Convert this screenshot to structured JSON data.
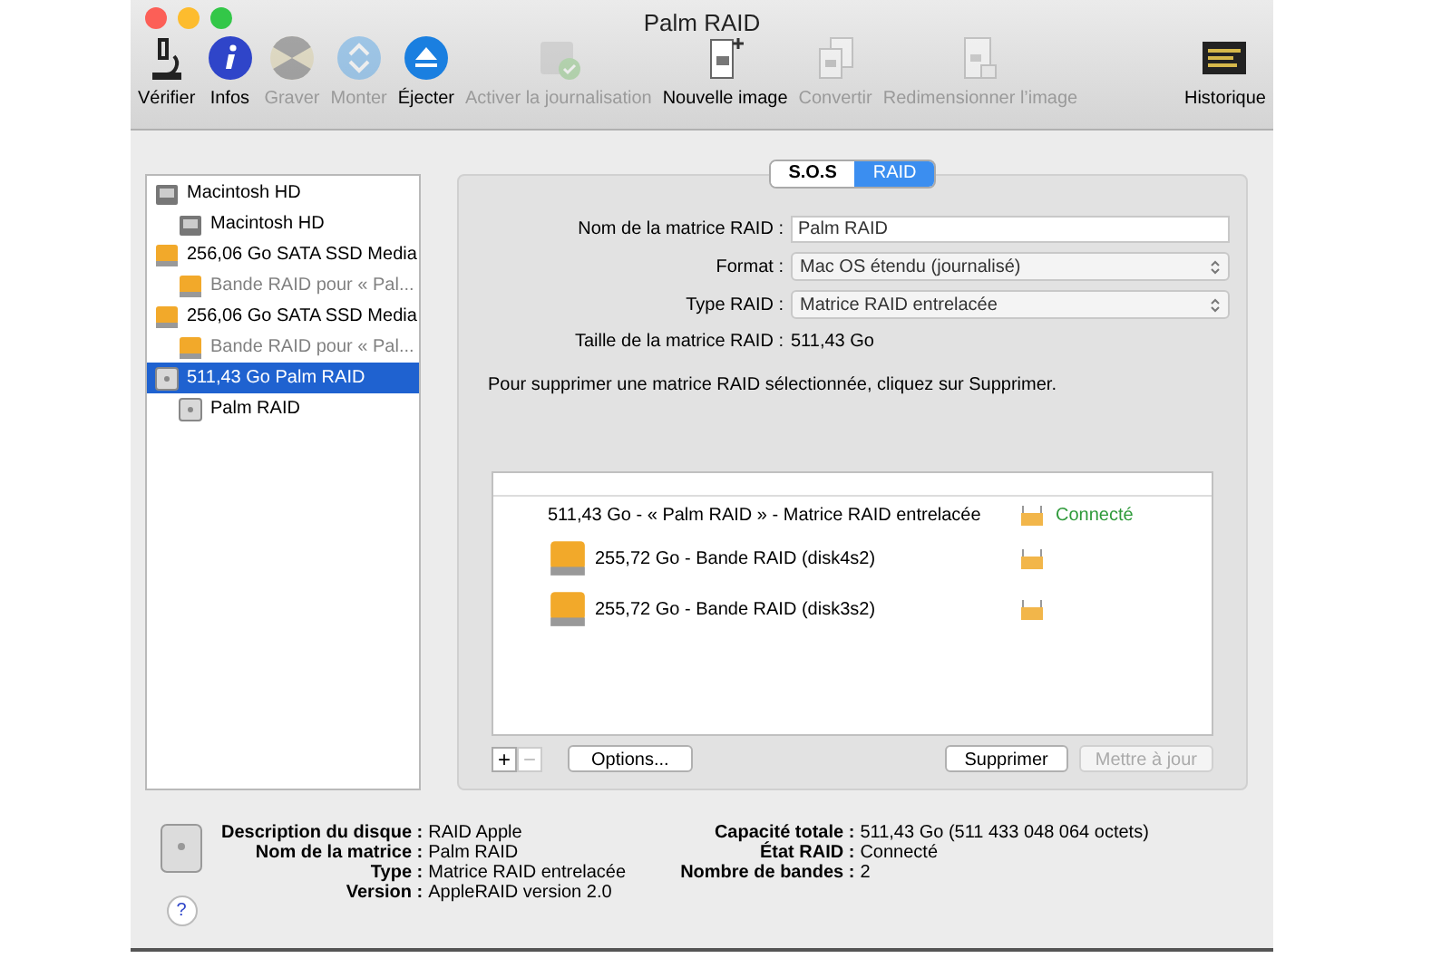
{
  "window": {
    "title": "Palm RAID"
  },
  "toolbar": [
    {
      "label": "Vérifier",
      "disabled": false
    },
    {
      "label": "Infos",
      "disabled": false
    },
    {
      "label": "Graver",
      "disabled": true
    },
    {
      "label": "Monter",
      "disabled": true
    },
    {
      "label": "Éjecter",
      "disabled": false
    },
    {
      "label": "Activer la journalisation",
      "disabled": true
    },
    {
      "label": "Nouvelle image",
      "disabled": false
    },
    {
      "label": "Convertir",
      "disabled": true
    },
    {
      "label": "Redimensionner l’image",
      "disabled": true
    },
    {
      "label": "Historique",
      "disabled": false
    }
  ],
  "sidebar": {
    "items": [
      {
        "label": "Macintosh HD",
        "kind": "hd",
        "selected": false,
        "dimmed": false,
        "children": [
          {
            "label": "Macintosh HD",
            "kind": "hd",
            "selected": false,
            "dimmed": false
          }
        ]
      },
      {
        "label": "256,06 Go SATA SSD Media",
        "kind": "ssd",
        "selected": false,
        "dimmed": false,
        "children": [
          {
            "label": "Bande RAID pour « Pal...",
            "kind": "ssd",
            "selected": false,
            "dimmed": true
          }
        ]
      },
      {
        "label": "256,06 Go SATA SSD Media",
        "kind": "ssd",
        "selected": false,
        "dimmed": false,
        "children": [
          {
            "label": "Bande RAID pour « Pal...",
            "kind": "ssd",
            "selected": false,
            "dimmed": true
          }
        ]
      },
      {
        "label": "511,43 Go Palm RAID",
        "kind": "raid",
        "selected": true,
        "dimmed": false,
        "children": [
          {
            "label": "Palm RAID",
            "kind": "raid",
            "selected": false,
            "dimmed": false
          }
        ]
      }
    ]
  },
  "tabs": [
    {
      "label": "S.O.S",
      "selected": false
    },
    {
      "label": "RAID",
      "selected": true
    }
  ],
  "form": {
    "name_label": "Nom de la matrice RAID :",
    "name_value": "Palm RAID",
    "format_label": "Format :",
    "format_value": "Mac OS étendu (journalisé)",
    "type_label": "Type RAID :",
    "type_value": "Matrice RAID entrelacée",
    "size_label": "Taille de la matrice RAID :",
    "size_value": "511,43 Go",
    "hint": "Pour supprimer une matrice RAID sélectionnée, cliquez sur Supprimer."
  },
  "raid_list": [
    {
      "kind": "set",
      "label": "511,43 Go - « Palm RAID » - Matrice RAID entrelacée",
      "status": "Connecté",
      "color": "#2e9a3a"
    },
    {
      "kind": "member",
      "label": "255,72 Go - Bande RAID (disk4s2)"
    },
    {
      "kind": "member",
      "label": "255,72 Go - Bande RAID (disk3s2)"
    }
  ],
  "list_buttons": {
    "add": "+",
    "remove": "−",
    "remove_disabled": true,
    "options": "Options...",
    "delete": "Supprimer",
    "update": "Mettre à jour",
    "update_disabled": true
  },
  "info": {
    "left": [
      {
        "label": "Description du disque :",
        "value": "RAID Apple"
      },
      {
        "label": "Nom de la matrice :",
        "value": "Palm RAID"
      },
      {
        "label": "Type :",
        "value": "Matrice RAID entrelacée"
      },
      {
        "label": "Version :",
        "value": "AppleRAID version 2.0"
      }
    ],
    "right": [
      {
        "label": "Capacité totale :",
        "value": "511,43 Go (511 433 048 064 octets)"
      },
      {
        "label": "État RAID :",
        "value": "Connecté"
      },
      {
        "label": "Nombre de bandes :",
        "value": "2"
      }
    ]
  },
  "help": "?"
}
